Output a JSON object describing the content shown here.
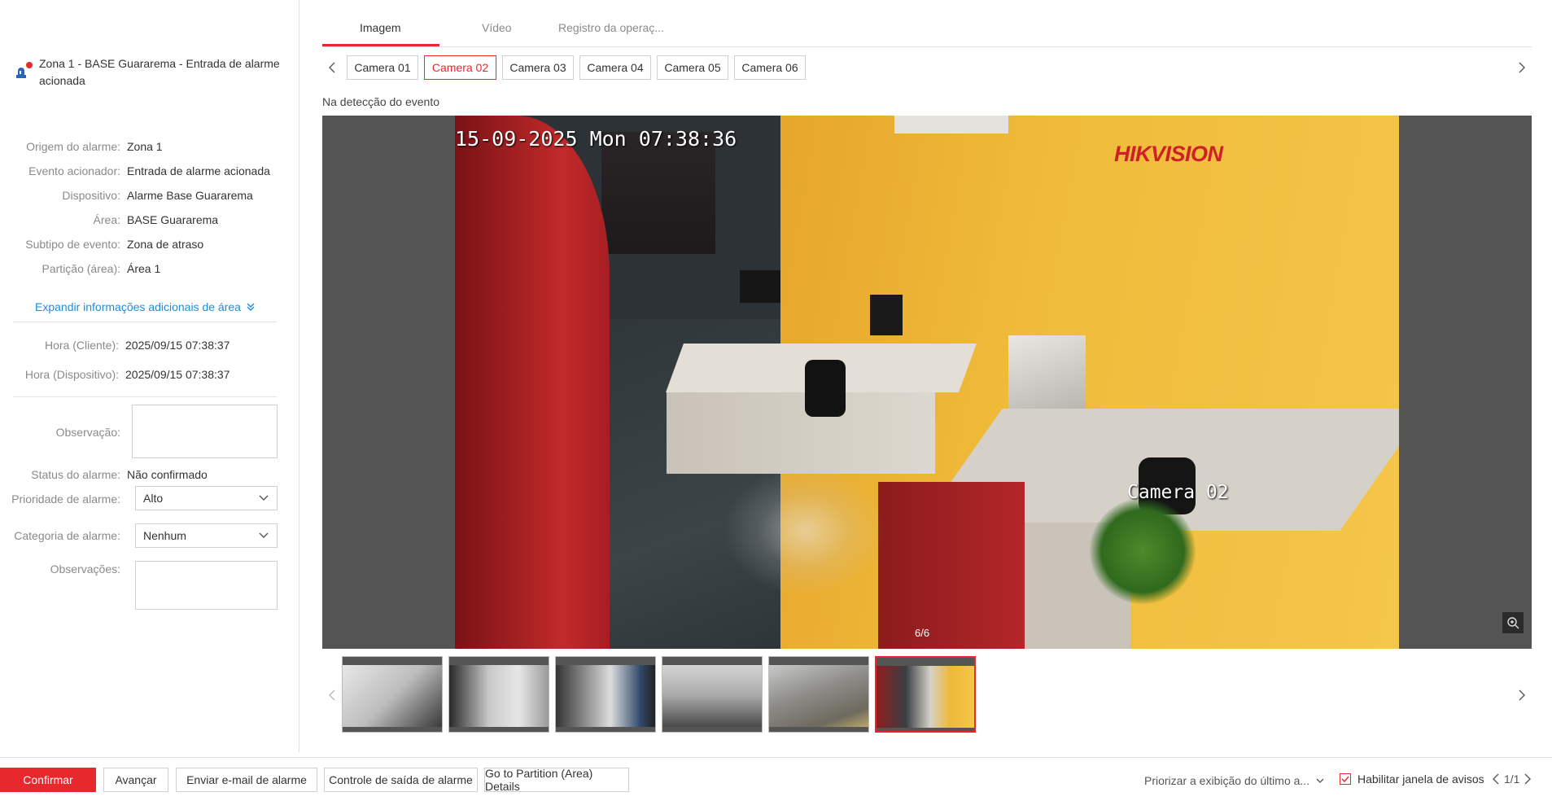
{
  "alarm": {
    "title": "Zona 1 - BASE Guararema - Entrada de alarme acionada",
    "accent": "#e7292e"
  },
  "info": [
    {
      "label": "Origem do alarme:",
      "value": "Zona 1"
    },
    {
      "label": "Evento acionador:",
      "value": "Entrada de alarme acionada"
    },
    {
      "label": "Dispositivo:",
      "value": "Alarme Base Guararema"
    },
    {
      "label": "Área:",
      "value": "BASE Guararema"
    },
    {
      "label": "Subtipo de evento:",
      "value": "Zona de atraso"
    },
    {
      "label": "Partição (área):",
      "value": "Área 1"
    }
  ],
  "expand_label": "Expandir informações adicionais de área",
  "times": [
    {
      "label": "Hora (Cliente):",
      "value": "2025/09/15 07:38:37"
    },
    {
      "label": "Hora (Dispositivo):",
      "value": "2025/09/15 07:38:37"
    }
  ],
  "form": {
    "observation_label": "Observação:",
    "status_label": "Status do alarme:",
    "status_value": "Não confirmado",
    "priority_label": "Prioridade de alarme:",
    "priority_value": "Alto",
    "category_label": "Categoria de alarme:",
    "category_value": "Nenhum",
    "remarks_label": "Observações:"
  },
  "tabs": [
    "Imagem",
    "Vídeo",
    "Registro da operaç..."
  ],
  "cameras": [
    "Camera 01",
    "Camera 02",
    "Camera 03",
    "Camera 04",
    "Camera 05",
    "Camera 06"
  ],
  "event_label": "Na detecção do evento",
  "viewer": {
    "osd_date": "15-09-2025 Mon 07:38:36",
    "osd_camera": "Camera 02",
    "brand": "HIKVISION",
    "counter": "6/6"
  },
  "footer": {
    "confirm": "Confirmar",
    "advance": "Avançar",
    "email": "Enviar e-mail de alarme",
    "exit_control": "Controle de saída de alarme",
    "partition": "Go to Partition (Area) Details",
    "priority_display": "Priorizar a exibição do último a...",
    "enable_popup": "Habilitar janela de avisos",
    "page": "1/1"
  }
}
